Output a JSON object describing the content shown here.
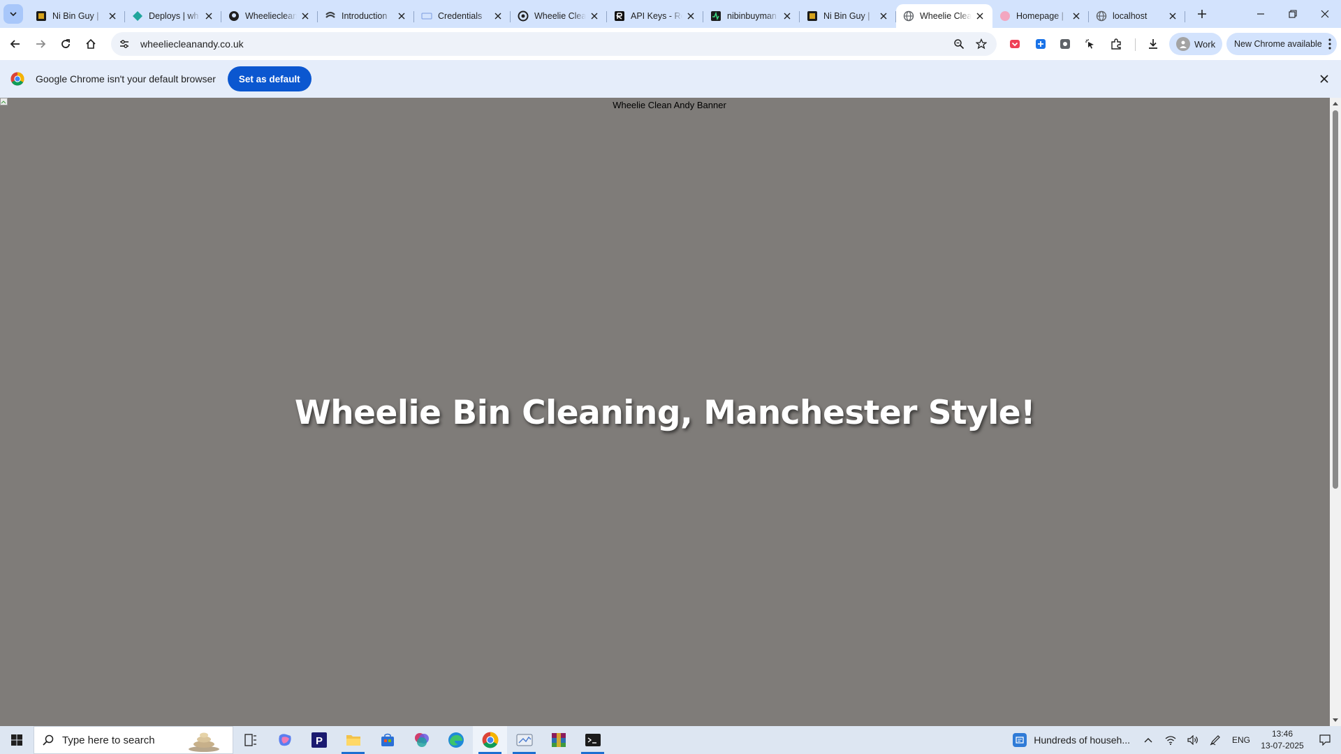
{
  "browser": {
    "tabs": [
      {
        "title": "Ni Bin Guy | ",
        "favicon": "nibinguy-favicon",
        "active": false
      },
      {
        "title": "Deploys | wh",
        "favicon": "netlify-favicon",
        "active": false
      },
      {
        "title": "Wheelieclean",
        "favicon": "github-favicon",
        "active": false
      },
      {
        "title": "Introduction",
        "favicon": "docs-favicon",
        "active": false
      },
      {
        "title": "Credentials",
        "favicon": "api-favicon",
        "active": false
      },
      {
        "title": "Wheelie Clea",
        "favicon": "openai-favicon",
        "active": false
      },
      {
        "title": "API Keys - Re",
        "favicon": "resend-favicon",
        "active": false
      },
      {
        "title": "nibinbuyman",
        "favicon": "pulse-favicon",
        "active": false
      },
      {
        "title": "Ni Bin Guy | ",
        "favicon": "nibinguy-favicon",
        "active": false
      },
      {
        "title": "Wheelie Clea",
        "favicon": "globe-favicon",
        "active": true
      },
      {
        "title": "Homepage | ",
        "favicon": "pink-favicon",
        "active": false
      },
      {
        "title": "localhost",
        "favicon": "globe-favicon",
        "active": false
      }
    ],
    "url": "wheeliecleanandy.co.uk",
    "profile_label": "Work",
    "update_label": "New Chrome available",
    "accent_color": "#0b57d0"
  },
  "infobar": {
    "message": "Google Chrome isn't your default browser",
    "button_label": "Set as default"
  },
  "page": {
    "banner_alt": "Wheelie Clean Andy Banner",
    "hero_title": "Wheelie Bin Cleaning, Manchester Style!",
    "background_color": "#7f7c79"
  },
  "taskbar": {
    "search_placeholder": "Type here to search",
    "news_text": "Hundreds of househ...",
    "language": "ENG",
    "time": "13:46",
    "date": "13-07-2025"
  }
}
